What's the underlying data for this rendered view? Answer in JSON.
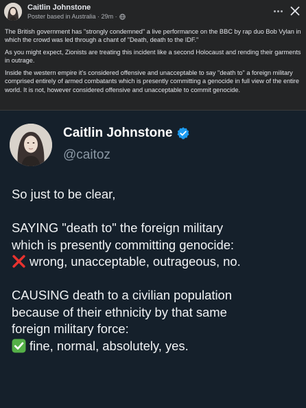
{
  "post": {
    "author": "Caitlin Johnstone",
    "meta_text": "Poster based in Australia · 29m ·",
    "icons": {
      "globe": "globe-icon",
      "more": "more-options-icon",
      "close": "close-icon"
    },
    "paragraphs": [
      "The British government has \"strongly condemned\" a live performance on the BBC by rap duo Bob Vylan in which the crowd was led through a chant of \"Death, death to the IDF.\"",
      "As you might expect, Zionists are treating this incident like a second Holocaust and rending their garments in outrage.",
      "Inside the western empire it's considered offensive and unacceptable to say \"death to\" a foreign military comprised entirely of armed combatants which is presently committing a genocide in full view of the entire world. It is not, however considered offensive and unacceptable to commit genocide."
    ]
  },
  "tweet": {
    "name": "Caitlin Johnstone",
    "handle": "@caitoz",
    "verified_icon": "verified-badge-icon",
    "verified_color": "#1d9bf0",
    "lines": {
      "intro": "So just to be clear,",
      "saying_1": "SAYING \"death to\" the foreign military",
      "saying_2": "which is presently committing genocide:",
      "saying_verdict": "wrong, unacceptable, outrageous, no.",
      "causing_1": "CAUSING death to a civilian population",
      "causing_2": "because of their ethnicity by that same",
      "causing_3": "foreign military force:",
      "causing_verdict": "fine, normal, absolutely, yes."
    },
    "emoji": {
      "cross": "red-cross-mark-icon",
      "check": "green-check-mark-icon"
    },
    "colors": {
      "background": "#15202b",
      "text": "#f1f3f5",
      "handle": "#8b98a5"
    }
  }
}
